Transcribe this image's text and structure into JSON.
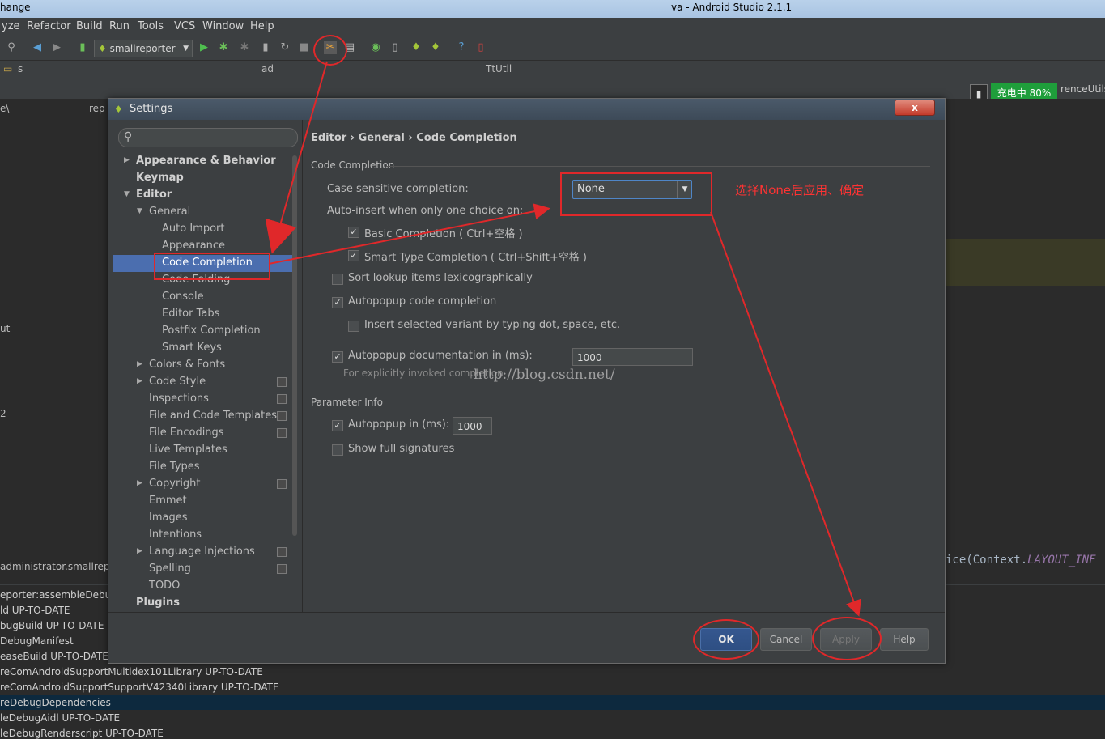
{
  "window": {
    "title_left": "hange",
    "title_right": "va - Android Studio 2.1.1"
  },
  "menu": [
    "yze",
    "Refactor",
    "Build",
    "Run",
    "Tools",
    "VCS",
    "Window",
    "Help"
  ],
  "toolbar": {
    "run_config": "smallreporter"
  },
  "navbar": {
    "path_fragments": [
      "s",
      "ad",
      "TtUtil"
    ]
  },
  "battery": {
    "label": "充电中 80%"
  },
  "editor": {
    "tab_fragment": "renceUtils",
    "code_text": "ice(Context.",
    "code_const": "LAYOUT_INF"
  },
  "left_strip": {
    "fragments": [
      "e\\",
      "rep",
      "ut",
      "2",
      "administrator.smallrep"
    ]
  },
  "build_output": [
    "eporter:assembleDebu",
    "ld UP-TO-DATE",
    "bugBuild UP-TO-DATE",
    "DebugManifest",
    "easeBuild UP-TO-DATE",
    "reComAndroidSupportMultidex101Library UP-TO-DATE",
    "reComAndroidSupportSupportV42340Library UP-TO-DATE",
    "reDebugDependencies",
    "leDebugAidl UP-TO-DATE",
    "leDebugRenderscript UP-TO-DATE"
  ],
  "dialog": {
    "title": "Settings",
    "close_label": "x",
    "search_placeholder": "",
    "tree": [
      {
        "label": "Appearance & Behavior",
        "bold": true,
        "arrow": "right"
      },
      {
        "label": "Keymap",
        "bold": true
      },
      {
        "label": "Editor",
        "bold": true,
        "arrow": "down"
      },
      {
        "label": "General",
        "arrow": "down"
      },
      {
        "label": "Auto Import"
      },
      {
        "label": "Appearance"
      },
      {
        "label": "Code Completion",
        "selected": true
      },
      {
        "label": "Code Folding"
      },
      {
        "label": "Console"
      },
      {
        "label": "Editor Tabs"
      },
      {
        "label": "Postfix Completion"
      },
      {
        "label": "Smart Keys"
      },
      {
        "label": "Colors & Fonts",
        "arrow": "right"
      },
      {
        "label": "Code Style",
        "arrow": "right",
        "copy": true
      },
      {
        "label": "Inspections",
        "copy": true
      },
      {
        "label": "File and Code Templates",
        "copy": true
      },
      {
        "label": "File Encodings",
        "copy": true
      },
      {
        "label": "Live Templates"
      },
      {
        "label": "File Types"
      },
      {
        "label": "Copyright",
        "arrow": "right",
        "copy": true
      },
      {
        "label": "Emmet"
      },
      {
        "label": "Images"
      },
      {
        "label": "Intentions"
      },
      {
        "label": "Language Injections",
        "arrow": "right",
        "copy": true
      },
      {
        "label": "Spelling",
        "copy": true
      },
      {
        "label": "TODO"
      },
      {
        "label": "Plugins",
        "bold": true
      }
    ],
    "breadcrumb": "Editor › General › Code Completion",
    "code_completion": {
      "section_title": "Code Completion",
      "case_sensitive_label": "Case sensitive completion:",
      "case_sensitive_value": "None",
      "auto_insert_label": "Auto-insert when only one choice on:",
      "basic_completion": {
        "label": "Basic Completion ( Ctrl+空格 )",
        "checked": true
      },
      "smart_type_completion": {
        "label": "Smart Type Completion ( Ctrl+Shift+空格 )",
        "checked": true
      },
      "sort_lookup": {
        "label": "Sort lookup items lexicographically",
        "checked": false
      },
      "autopopup_code": {
        "label": "Autopopup code completion",
        "checked": true
      },
      "insert_selected": {
        "label": "Insert selected variant by typing dot, space, etc.",
        "checked": false
      },
      "autopopup_doc": {
        "label": "Autopopup documentation in (ms):",
        "checked": true,
        "value": "1000"
      },
      "autopopup_doc_hint": "For explicitly invoked completion"
    },
    "parameter_info": {
      "section_title": "Parameter Info",
      "autopopup": {
        "label": "Autopopup in (ms):",
        "checked": true,
        "value": "1000"
      },
      "full_signatures": {
        "label": "Show full signatures",
        "checked": false
      }
    },
    "buttons": {
      "ok": "OK",
      "cancel": "Cancel",
      "apply": "Apply",
      "help": "Help"
    }
  },
  "watermark": "http://blog.csdn.net/",
  "annotation": {
    "note": "选择None后应用、确定",
    "color": "#e0282a"
  }
}
